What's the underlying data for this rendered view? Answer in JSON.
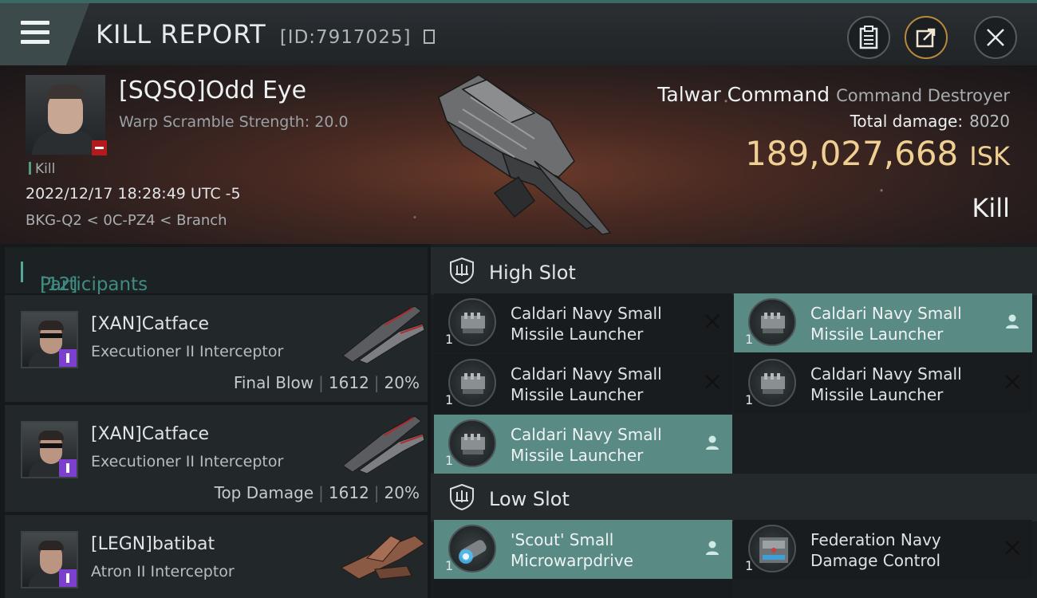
{
  "header": {
    "title": "KILL REPORT",
    "report_id": "[ID:7917025]"
  },
  "victim": {
    "name": "[SQSQ]Odd Eye",
    "subtitle": "Warp Scramble Strength: 20.0",
    "tag": "Kill",
    "timestamp": "2022/12/17 18:28:49 UTC -5",
    "location": "BKG-Q2 < 0C-PZ4 < Branch",
    "ship_name": "Talwar Command",
    "ship_class": "Command Destroyer",
    "total_damage_label": "Total damage:",
    "total_damage_value": "8020",
    "isk_value": "189,027,668",
    "isk_unit": "ISK",
    "result": "Kill"
  },
  "participants": {
    "label": "Participants",
    "count": "[12]",
    "rows": [
      {
        "name": "[XAN]Catface",
        "ship": "Executioner II Interceptor",
        "role": "Final Blow",
        "damage": "1612",
        "percent": "20%"
      },
      {
        "name": "[XAN]Catface",
        "ship": "Executioner II Interceptor",
        "role": "Top Damage",
        "damage": "1612",
        "percent": "20%"
      },
      {
        "name": "[LEGN]batibat",
        "ship": "Atron II Interceptor",
        "role": "",
        "damage": "",
        "percent": ""
      }
    ]
  },
  "slots": {
    "high": {
      "label": "High Slot",
      "modules": [
        {
          "name_line1": "Caldari Navy Small",
          "name_line2": "Missile Launcher",
          "qty": "1",
          "state": "destroyed"
        },
        {
          "name_line1": "Caldari Navy Small",
          "name_line2": "Missile Launcher",
          "qty": "1",
          "state": "dropped"
        },
        {
          "name_line1": "Caldari Navy Small",
          "name_line2": "Missile Launcher",
          "qty": "1",
          "state": "destroyed"
        },
        {
          "name_line1": "Caldari Navy Small",
          "name_line2": "Missile Launcher",
          "qty": "1",
          "state": "destroyed"
        },
        {
          "name_line1": "Caldari Navy Small",
          "name_line2": "Missile Launcher",
          "qty": "1",
          "state": "dropped"
        }
      ]
    },
    "low": {
      "label": "Low Slot",
      "modules": [
        {
          "name_line1": "'Scout' Small",
          "name_line2": "Microwarpdrive",
          "qty": "1",
          "state": "dropped"
        },
        {
          "name_line1": "Federation Navy",
          "name_line2": "Damage Control",
          "qty": "1",
          "state": "destroyed"
        }
      ]
    }
  },
  "colors": {
    "accent_teal": "#3f8c82",
    "isk_gold": "#efcf92",
    "dropped_bg": "#5a8a84",
    "badge_purple": "#7c3fd0",
    "badge_red": "#b3191d"
  }
}
